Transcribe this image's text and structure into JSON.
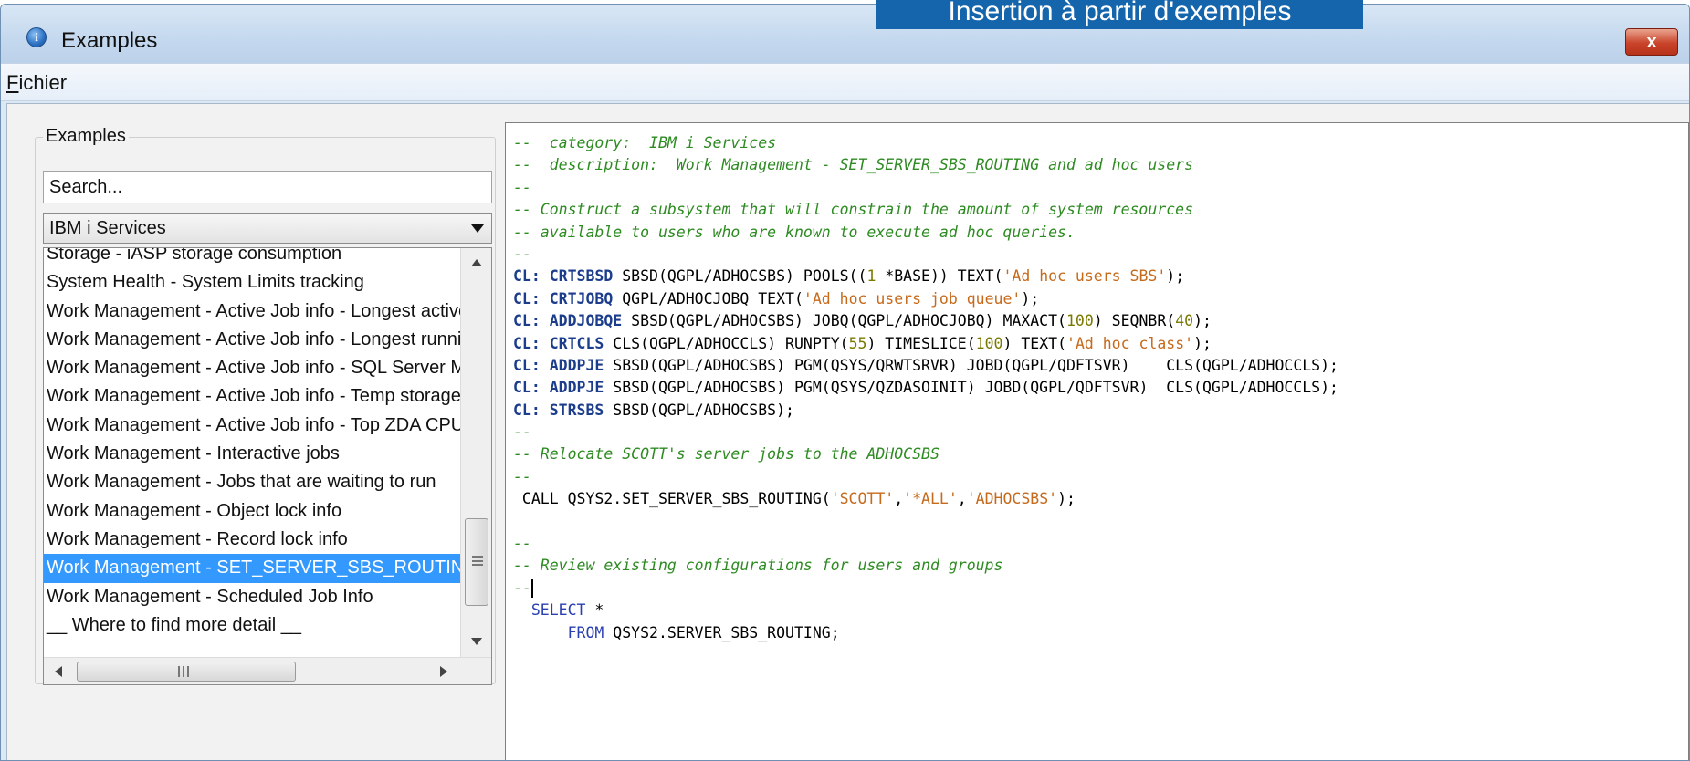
{
  "banner": {
    "text": "Insertion à partir d'exemples"
  },
  "window": {
    "title": "Examples",
    "close_symbol": "x"
  },
  "menu": {
    "file_underlined": "F",
    "file_rest": "ichier"
  },
  "left_panel": {
    "group_label": "Examples",
    "search_placeholder": "Search...",
    "category_selected": "IBM i Services",
    "items": [
      "Storage - iASP storage consumption",
      "System Health - System Limits tracking",
      "Work Management - Active Job info - Longest active",
      "Work Management - Active Job info - Longest runni",
      "Work Management - Active Job info - SQL Server M",
      "Work Management - Active Job info - Temp storage",
      "Work Management - Active Job info - Top ZDA CPU",
      "Work Management - Interactive jobs",
      "Work Management - Jobs that are waiting to run",
      "Work Management - Object lock info",
      "Work Management - Record lock info",
      "Work Management - SET_SERVER_SBS_ROUTING a",
      "Work Management - Scheduled Job Info",
      "__ Where to find more detail __"
    ],
    "selected_index": 11
  },
  "editor": {
    "colors": {
      "comment": "#2e8b22",
      "keyword": "#1c3d8c",
      "string": "#c66a1c",
      "number": "#7a7a00"
    },
    "lines": [
      [
        [
          "c",
          "--  category:  IBM i Services"
        ]
      ],
      [
        [
          "c",
          "--  description:  Work Management - SET_SERVER_SBS_ROUTING and ad hoc users"
        ]
      ],
      [
        [
          "c",
          "--"
        ]
      ],
      [
        [
          "c",
          "-- Construct a subsystem that will constrain the amount of system resources"
        ]
      ],
      [
        [
          "c",
          "-- available to users who are known to execute ad hoc queries."
        ]
      ],
      [
        [
          "c",
          "--"
        ]
      ],
      [
        [
          "k",
          "CL: CRTSBSD"
        ],
        [
          "p",
          " SBSD(QGPL/ADHOCSBS) POOLS(("
        ],
        [
          "n",
          "1"
        ],
        [
          "p",
          " *BASE)) TEXT("
        ],
        [
          "s",
          "'Ad hoc users SBS'"
        ],
        [
          "p",
          ");"
        ]
      ],
      [
        [
          "k",
          "CL: CRTJOBQ"
        ],
        [
          "p",
          " QGPL/ADHOCJOBQ TEXT("
        ],
        [
          "s",
          "'Ad hoc users job queue'"
        ],
        [
          "p",
          ");"
        ]
      ],
      [
        [
          "k",
          "CL: ADDJOBQE"
        ],
        [
          "p",
          " SBSD(QGPL/ADHOCSBS) JOBQ(QGPL/ADHOCJOBQ) MAXACT("
        ],
        [
          "n",
          "100"
        ],
        [
          "p",
          ") SEQNBR("
        ],
        [
          "n",
          "40"
        ],
        [
          "p",
          ");"
        ]
      ],
      [
        [
          "k",
          "CL: CRTCLS"
        ],
        [
          "p",
          " CLS(QGPL/ADHOCCLS) RUNPTY("
        ],
        [
          "n",
          "55"
        ],
        [
          "p",
          ") TIMESLICE("
        ],
        [
          "n",
          "100"
        ],
        [
          "p",
          ") TEXT("
        ],
        [
          "s",
          "'Ad hoc class'"
        ],
        [
          "p",
          ");"
        ]
      ],
      [
        [
          "k",
          "CL: ADDPJE"
        ],
        [
          "p",
          " SBSD(QGPL/ADHOCSBS) PGM(QSYS/QRWTSRVR) JOBD(QGPL/QDFTSVR)    CLS(QGPL/ADHOCCLS);"
        ]
      ],
      [
        [
          "k",
          "CL: ADDPJE"
        ],
        [
          "p",
          " SBSD(QGPL/ADHOCSBS) PGM(QSYS/QZDASOINIT) JOBD(QGPL/QDFTSVR)  CLS(QGPL/ADHOCCLS);"
        ]
      ],
      [
        [
          "k",
          "CL: STRSBS"
        ],
        [
          "p",
          " SBSD(QGPL/ADHOCSBS);"
        ]
      ],
      [
        [
          "c",
          "--"
        ]
      ],
      [
        [
          "c",
          "-- Relocate SCOTT's server jobs to the ADHOCSBS"
        ]
      ],
      [
        [
          "c",
          "--"
        ]
      ],
      [
        [
          "p",
          " CALL QSYS2.SET_SERVER_SBS_ROUTING("
        ],
        [
          "s",
          "'SCOTT'"
        ],
        [
          "p",
          ","
        ],
        [
          "s",
          "'*ALL'"
        ],
        [
          "p",
          ","
        ],
        [
          "s",
          "'ADHOCSBS'"
        ],
        [
          "p",
          ");"
        ]
      ],
      [
        [
          "p",
          ""
        ]
      ],
      [
        [
          "c",
          "--"
        ]
      ],
      [
        [
          "c",
          "-- Review existing configurations for users and groups"
        ]
      ],
      [
        [
          "c",
          "--"
        ],
        [
          "cursor",
          ""
        ]
      ],
      [
        [
          "q",
          "  SELECT"
        ],
        [
          "p",
          " *"
        ]
      ],
      [
        [
          "q",
          "      FROM"
        ],
        [
          "p",
          " QSYS2.SERVER_SBS_ROUTING;"
        ]
      ]
    ]
  }
}
